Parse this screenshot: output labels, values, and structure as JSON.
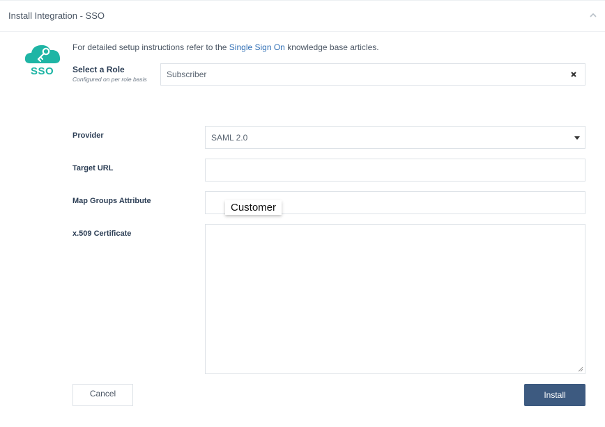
{
  "header": {
    "title": "Install Integration - SSO"
  },
  "logo": {
    "text": "SSO"
  },
  "intro": {
    "before": "For detailed setup instructions refer to the ",
    "link": "Single Sign On",
    "after": " knowledge base articles."
  },
  "role": {
    "label": "Select a Role",
    "sublabel": "Configured on per role basis",
    "value": "Subscriber"
  },
  "fields": {
    "provider": {
      "label": "Provider",
      "value": "SAML 2.0"
    },
    "target_url": {
      "label": "Target URL",
      "value": ""
    },
    "map_groups": {
      "label": "Map Groups Attribute",
      "value": ""
    },
    "certificate": {
      "label": "x.509 Certificate",
      "value": ""
    }
  },
  "tooltip": {
    "text": "Customer"
  },
  "buttons": {
    "cancel": "Cancel",
    "install": "Install"
  },
  "colors": {
    "brand": "#1fb5a5",
    "link": "#2f6eb5",
    "primary_button": "#3d5a80"
  },
  "icons": [
    "chevron-up-icon",
    "cloud-key-icon",
    "close-icon",
    "caret-down-icon",
    "resize-handle-icon"
  ]
}
